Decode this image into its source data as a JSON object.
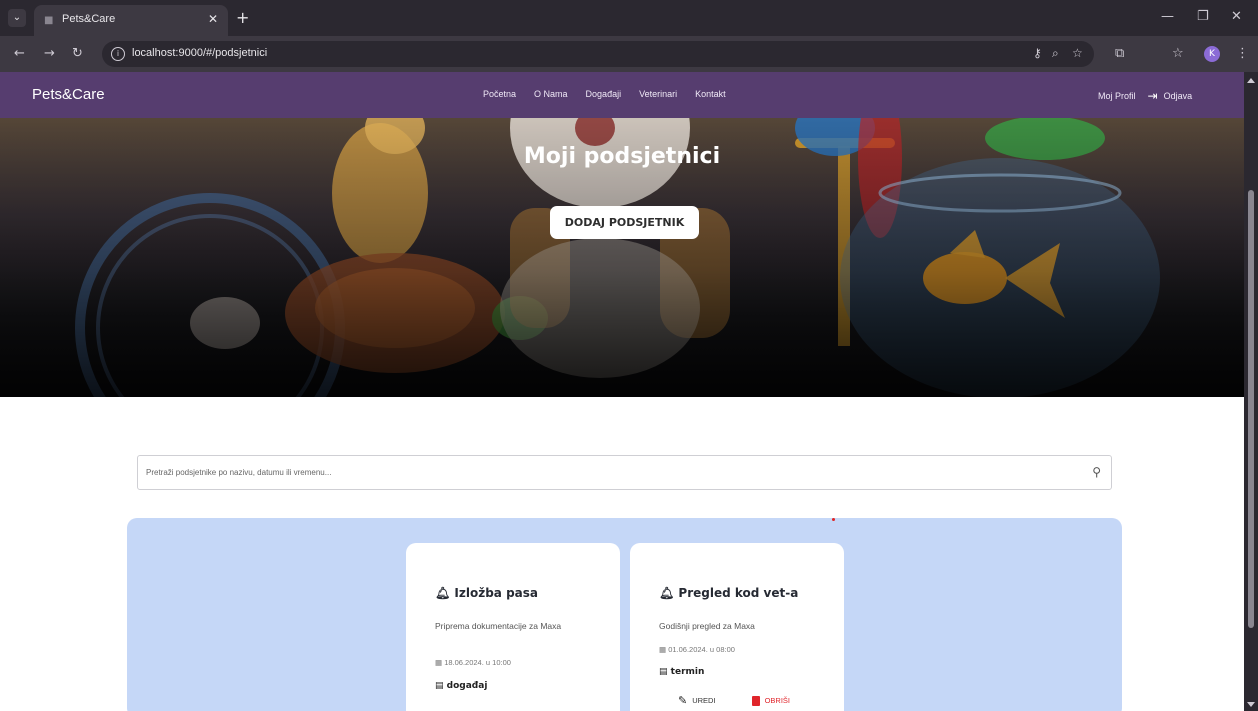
{
  "browser": {
    "tab_title": "Pets&Care",
    "url": "localhost:9000/#/podsjetnici",
    "profile_initial": "K"
  },
  "navbar": {
    "brand": "Pets&Care",
    "links": [
      "Početna",
      "O Nama",
      "Događaji",
      "Veterinari",
      "Kontakt"
    ],
    "profile": "Moj Profil",
    "logout": "Odjava"
  },
  "hero": {
    "title": "Moji podsjetnici",
    "button": "DODAJ PODSJETNIK"
  },
  "search": {
    "placeholder": "Pretraži podsjetnike po nazivu, datumu ili vremenu..."
  },
  "reminders": [
    {
      "title": "Izložba pasa",
      "description": "Priprema dokumentacije za Maxa",
      "datetime": "18.06.2024. u 10:00",
      "type": "događaj"
    },
    {
      "title": "Pregled kod vet-a",
      "description": "Godišnji pregled za Maxa",
      "datetime": "01.06.2024. u 08:00",
      "type": "termin",
      "edit": "UREDI",
      "delete": "OBRIŠI"
    }
  ],
  "icons": {
    "bell": "bell-icon",
    "calendar": "calendar-icon",
    "type": "tag-icon",
    "edit": "pencil-icon",
    "delete": "trash-icon",
    "search": "search-icon"
  },
  "colors": {
    "navbar": "#563d6f",
    "panel": "#c5d7f7",
    "delete": "#e0252b"
  }
}
